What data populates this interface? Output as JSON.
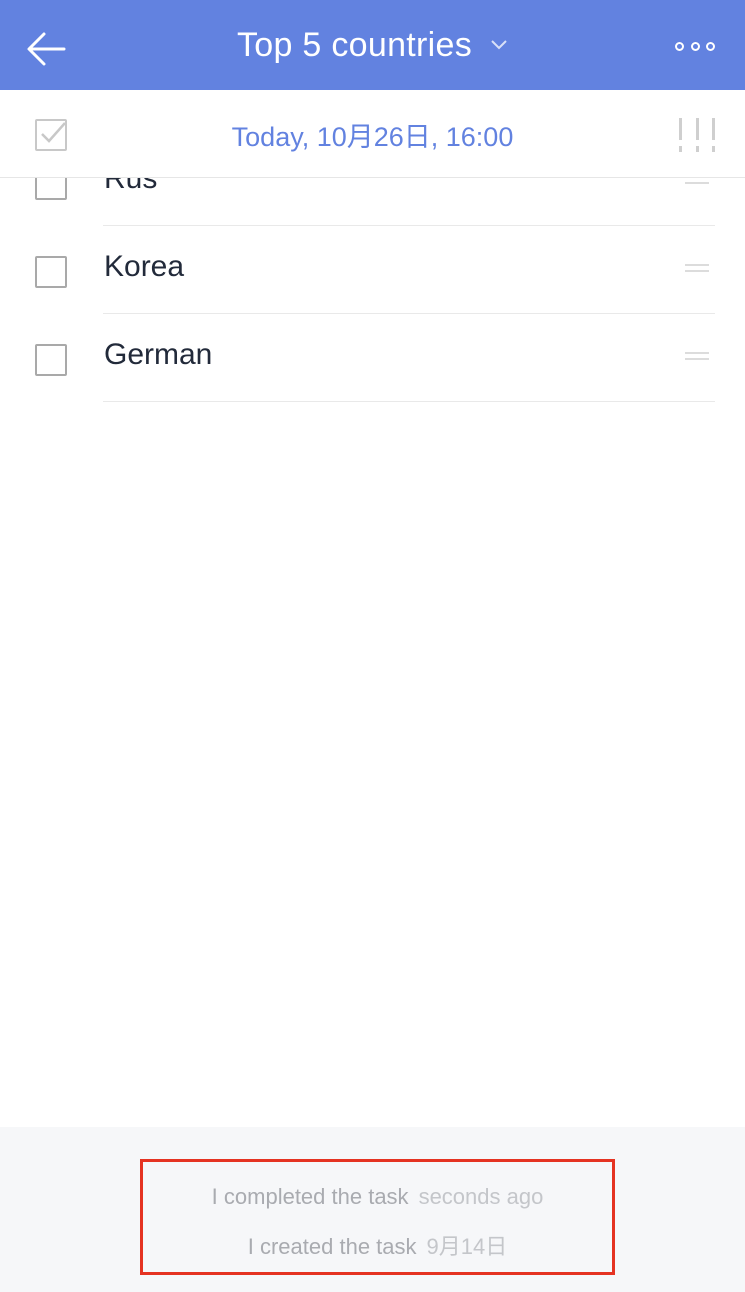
{
  "header": {
    "title": "Top 5 countries",
    "back_icon": "arrow-left-icon",
    "dropdown_icon": "chevron-down-icon",
    "more_icon": "more-dots-icon",
    "bg_color": "#6282e0"
  },
  "subheader": {
    "due_date": "Today, 10月26日, 16:00",
    "complete_icon": "checkbox-checked-icon",
    "priority_icon": "priority-icon",
    "accent_color": "#6282e0"
  },
  "items": [
    {
      "label": "Rus",
      "checked": false
    },
    {
      "label": "Korea",
      "checked": false
    },
    {
      "label": "German",
      "checked": false
    }
  ],
  "activity": [
    {
      "text": "I completed the task",
      "time": "seconds ago"
    },
    {
      "text": "I created the task",
      "time": "9月14日"
    }
  ]
}
